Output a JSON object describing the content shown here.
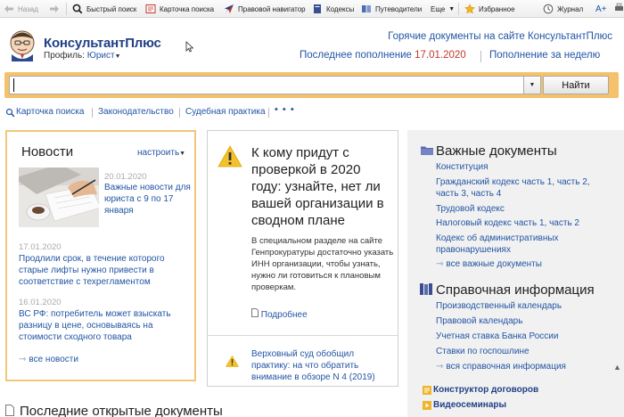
{
  "toolbar": {
    "back": "Назад",
    "quick_search": "Быстрый поиск",
    "search_card": "Карточка поиска",
    "legal_navigator": "Правовой навигатор",
    "codes": "Кодексы",
    "guides": "Путеводители",
    "more": "Еще",
    "favorites": "Избранное",
    "journal": "Журнал",
    "font_size": "A+"
  },
  "header": {
    "logo": "КонсультантПлюс",
    "profile_label": "Профиль:",
    "profile_value": "Юрист",
    "hot_docs": "Горячие документы на сайте КонсультантПлюс",
    "last_update_label": "Последнее пополнение",
    "last_update_date": "17.01.2020",
    "week_update": "Пополнение за неделю"
  },
  "search": {
    "value": "",
    "button": "Найти"
  },
  "quick_links": [
    "Карточка поиска",
    "Законодательство",
    "Судебная практика"
  ],
  "quick_links_more": "• • •",
  "news": {
    "title": "Новости",
    "configure": "настроить",
    "items": [
      {
        "date": "20.01.2020",
        "text": "Важные новости для юриста с 9 по 17 января"
      },
      {
        "date": "17.01.2020",
        "text": "Продлили срок, в течение которого старые лифты нужно привести в соответствие с техрегламентом"
      },
      {
        "date": "16.01.2020",
        "text": "ВС РФ: потребитель может взыскать разницу в цене, основываясь на стоимости сходного товара"
      }
    ],
    "all": "все новости"
  },
  "feature": {
    "title": "К кому придут с проверкой в 2020 году: узнайте, нет ли вашей организации в сводном плане",
    "body": "В специальном разделе на сайте Генпрокуратуры достаточно указать ИНН организации, чтобы узнать, нужно ли готовиться к плановым проверкам.",
    "more": "Подробнее",
    "second": "Верховный суд обобщил практику: на что обратить внимание в обзоре N 4 (2019)"
  },
  "important_docs": {
    "title": "Важные документы",
    "items": [
      "Конституция",
      "Гражданский кодекс часть 1, часть 2, часть 3, часть 4",
      "Трудовой кодекс",
      "Налоговый кодекс часть 1, часть 2",
      "Кодекс об административных правонарушениях"
    ],
    "all": "все важные документы"
  },
  "reference": {
    "title": "Справочная информация",
    "items": [
      "Производственный календарь",
      "Правовой календарь",
      "Учетная ставка Банка России",
      "Ставки по госпошлине"
    ],
    "all": "вся справочная информация"
  },
  "extra_links": [
    "Конструктор договоров",
    "Видеосеминары"
  ],
  "recent": "Последние открытые документы",
  "colors": {
    "accent_orange": "#f5c26b",
    "link_blue": "#2255a4",
    "brand_navy": "#1f3f86",
    "date_red": "#c0392b",
    "warning_yellow": "#f3c12c"
  }
}
